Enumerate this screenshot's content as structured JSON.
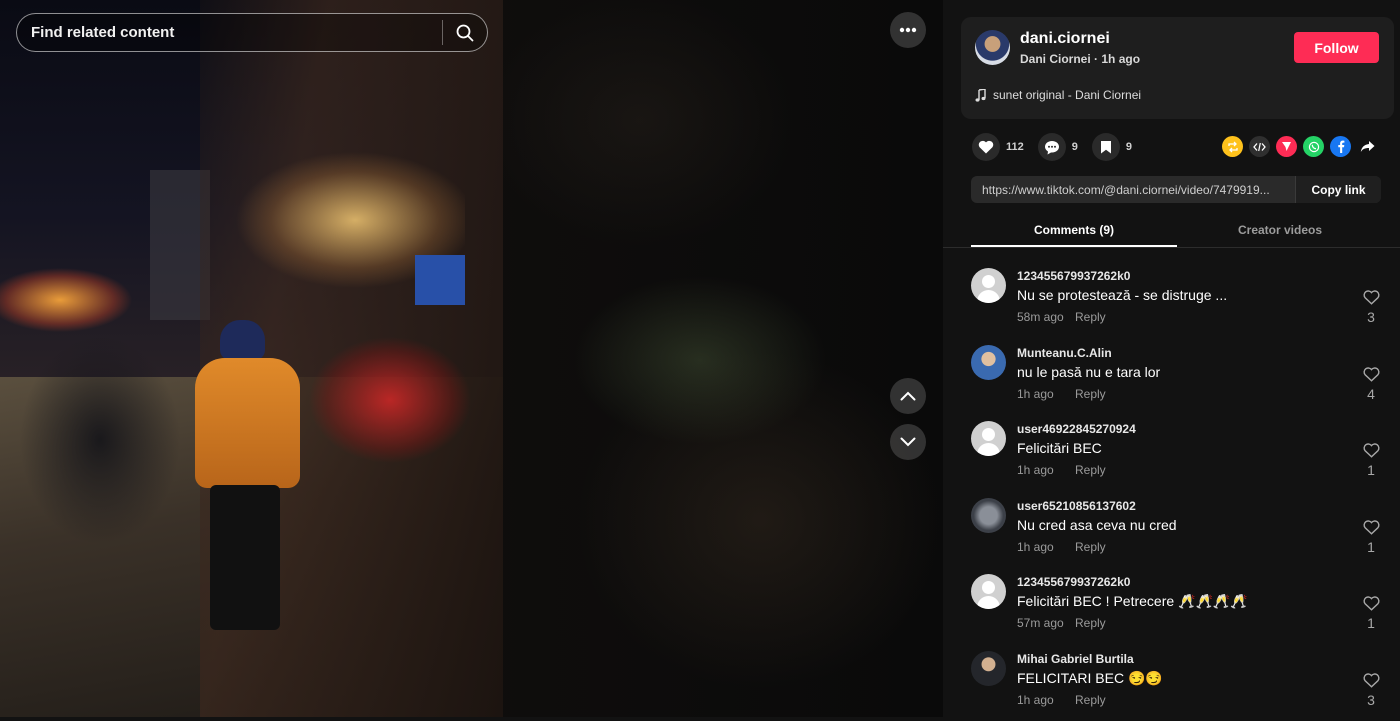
{
  "search": {
    "placeholder": "Find related content"
  },
  "author": {
    "username": "dani.ciornei",
    "display_name": "Dani Ciornei",
    "posted": "1h ago",
    "follow_label": "Follow",
    "music": "sunet original - Dani Ciornei"
  },
  "actions": {
    "likes": "112",
    "comments": "9",
    "saves": "9"
  },
  "share": {
    "link": "https://www.tiktok.com/@dani.ciornei/video/7479919...",
    "copy_label": "Copy link",
    "icons": [
      "repost-icon",
      "embed-icon",
      "send-icon",
      "whatsapp-icon",
      "facebook-icon",
      "share-arrow-icon"
    ]
  },
  "tabs": [
    {
      "label": "Comments (9)",
      "active": true
    },
    {
      "label": "Creator videos",
      "active": false
    }
  ],
  "comments": [
    {
      "user": "123455679937262k0",
      "text": "Nu se protestează - se distruge ...",
      "time": "58m ago",
      "reply": "Reply",
      "likes": "3",
      "avatar": "default"
    },
    {
      "user": "Munteanu.C.Alin",
      "text": "nu le pasă nu e tara lor",
      "time": "1h ago",
      "reply": "Reply",
      "likes": "4",
      "avatar": "photo"
    },
    {
      "user": "user46922845270924",
      "text": "Felicitări BEC",
      "time": "1h ago",
      "reply": "Reply",
      "likes": "1",
      "avatar": "default"
    },
    {
      "user": "user65210856137602",
      "text": "Nu cred asa ceva nu cred",
      "time": "1h ago",
      "reply": "Reply",
      "likes": "1",
      "avatar": "photo"
    },
    {
      "user": "123455679937262k0",
      "text": "Felicitări BEC ! Petrecere 🥂🥂🥂🥂",
      "time": "57m ago",
      "reply": "Reply",
      "likes": "1",
      "avatar": "default"
    },
    {
      "user": "Mihai Gabriel Burtila",
      "text": "FELICITARI BEC 😏😏",
      "time": "1h ago",
      "reply": "Reply",
      "likes": "3",
      "avatar": "photo"
    }
  ],
  "colors": {
    "accent": "#fe2c55",
    "background": "#121212",
    "card": "#1e1e1e"
  }
}
